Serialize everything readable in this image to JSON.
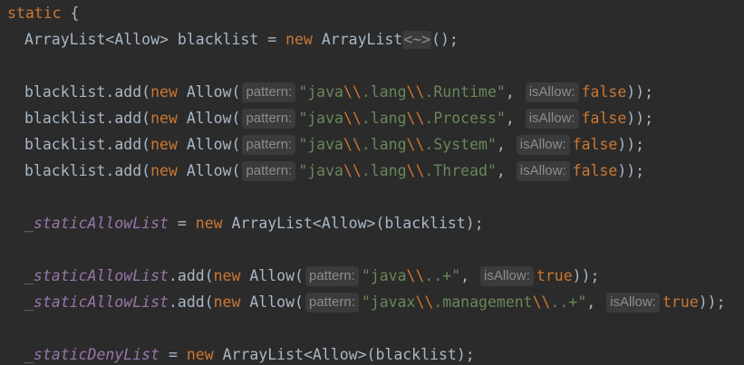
{
  "code": {
    "static_kw": "static",
    "open_brace": " {",
    "indent": "  ",
    "arraylist_allow": "ArrayList<Allow>",
    "blacklist_decl": " blacklist = ",
    "new_kw": "new",
    "arraylist": " ArrayList",
    "diamond_fold": "<~>",
    "call_end": "();",
    "add_prefix": "blacklist.add(",
    "allow_ctor": " Allow(",
    "pattern_hint": "pattern:",
    "isallow_hint": "isAllow:",
    "false_kw": "false",
    "true_kw": "true",
    "close_call": "));",
    "comma": ",",
    "q": "\"",
    "esc_bs": "\\\\",
    "java": "java",
    "javax": "javax",
    "lang": ".lang",
    "runtime": ".Runtime",
    "process": ".Process",
    "system": ".System",
    "thread": ".Thread",
    "dotdotplus": "..+",
    "management": ".management",
    "static_allow_list": "_staticAllowList",
    "static_deny_list": "_staticDenyList",
    "assign": " = ",
    "arraylist_allow_ctor": " ArrayList<Allow>(blacklist);",
    "dot_add": ".add(",
    "space": " "
  }
}
